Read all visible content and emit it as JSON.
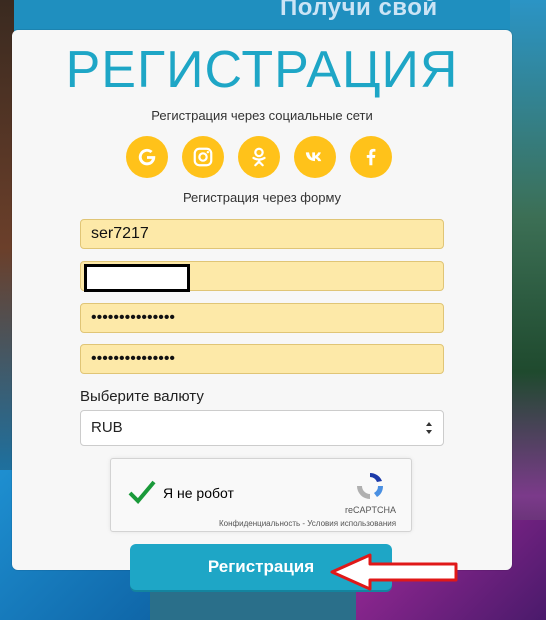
{
  "background": {
    "promo_text": "Получи свой"
  },
  "form": {
    "title": "РЕГИСТРАЦИЯ",
    "social_caption": "Регистрация через социальные сети",
    "social_buttons": [
      {
        "icon": "google-icon"
      },
      {
        "icon": "instagram-icon"
      },
      {
        "icon": "odnoklassniki-icon"
      },
      {
        "icon": "vk-icon"
      },
      {
        "icon": "facebook-icon"
      }
    ],
    "form_caption": "Регистрация через форму",
    "username_value": "ser7217",
    "password_mask": "•••••••••••••••",
    "password_confirm_mask": "•••••••••••••••",
    "currency_label": "Выберите валюту",
    "currency_value": "RUB",
    "captcha": {
      "label": "Я не робот",
      "brand": "reCAPTCHA",
      "links": "Конфиденциальность - Условия использования"
    },
    "submit_label": "Регистрация"
  },
  "colors": {
    "accent": "#1ea6c6",
    "social": "#ffc21a",
    "field_fill": "#fde9a8",
    "annotation": "#e01818"
  }
}
